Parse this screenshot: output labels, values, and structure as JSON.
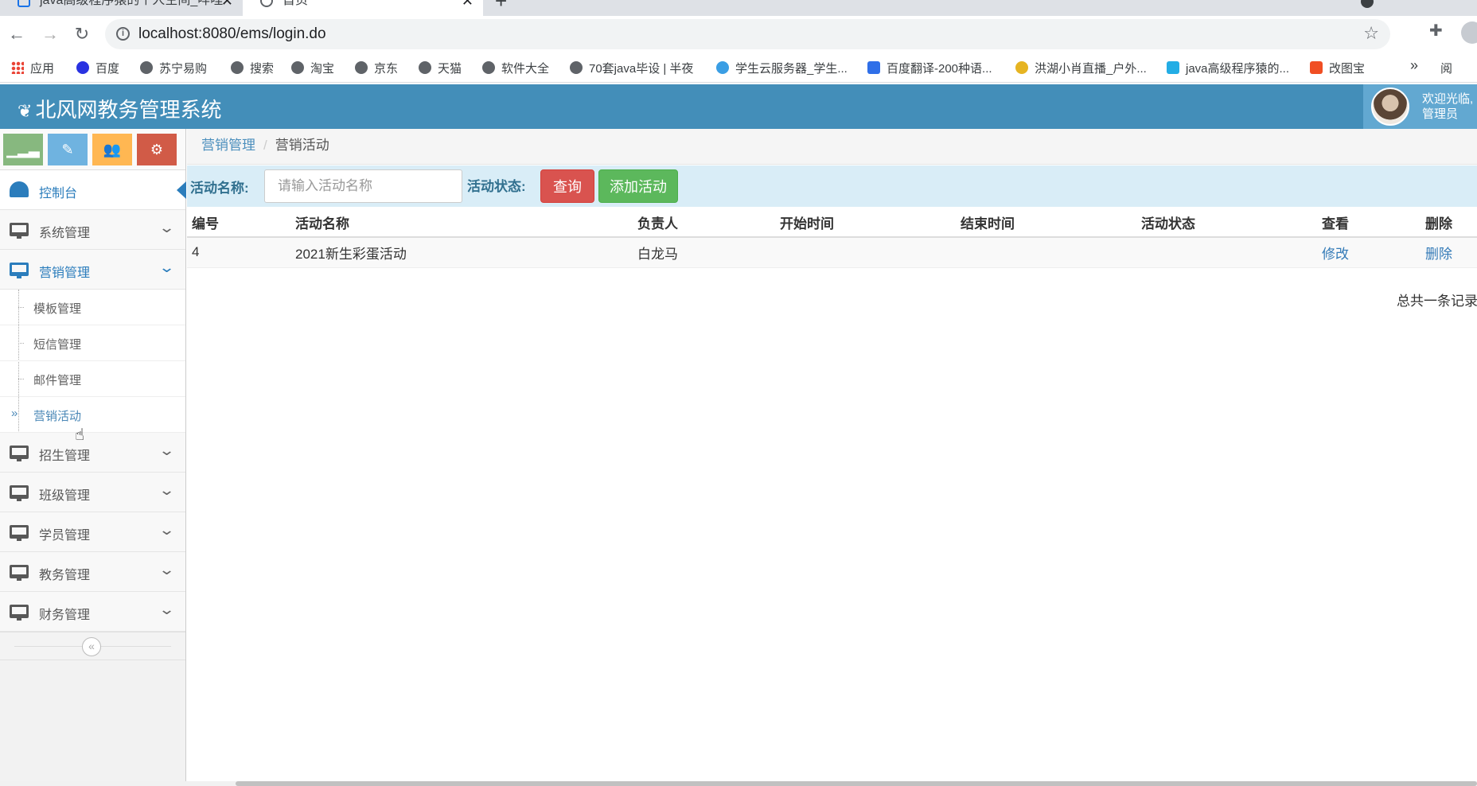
{
  "browser": {
    "tabs": [
      {
        "title": "java高级程序猿的个人空间_哔哩"
      },
      {
        "title": "首页"
      }
    ],
    "url": "localhost:8080/ems/login.do",
    "bookmarks": [
      {
        "label": "应用",
        "icon": "apps-grid-icon"
      },
      {
        "label": "百度",
        "icon": "baidu-paw-icon"
      },
      {
        "label": "苏宁易购",
        "icon": "globe-icon"
      },
      {
        "label": "搜索",
        "icon": "globe-icon"
      },
      {
        "label": "淘宝",
        "icon": "globe-icon"
      },
      {
        "label": "京东",
        "icon": "globe-icon"
      },
      {
        "label": "天猫",
        "icon": "globe-icon"
      },
      {
        "label": "软件大全",
        "icon": "globe-icon"
      },
      {
        "label": "70套java毕设 | 半夜",
        "icon": "globe-icon"
      },
      {
        "label": "学生云服务器_学生...",
        "icon": "cloud-icon"
      },
      {
        "label": "百度翻译-200种语...",
        "icon": "translate-icon"
      },
      {
        "label": "洪湖小肖直播_户外...",
        "icon": "live-icon"
      },
      {
        "label": "java高级程序猿的...",
        "icon": "bilibili-icon"
      },
      {
        "label": "改图宝",
        "icon": "image-tool-icon"
      }
    ],
    "bookmarks_more": "»",
    "reading_list": "阅"
  },
  "app": {
    "title": "北风网教务管理系统",
    "welcome_line1": "欢迎光临,",
    "welcome_line2": "管理员",
    "colors": {
      "header": "#438eb9",
      "user_box": "#62a8d1",
      "accent": "#2b7dbc",
      "shortcut_green": "#87b87f",
      "shortcut_blue": "#6fb3e0",
      "shortcut_orange": "#ffb752",
      "shortcut_red": "#d15b47"
    }
  },
  "sidebar": {
    "dashboard": "控制台",
    "menus": [
      {
        "label": "系统管理"
      },
      {
        "label": "营销管理"
      },
      {
        "label": "招生管理"
      },
      {
        "label": "班级管理"
      },
      {
        "label": "学员管理"
      },
      {
        "label": "教务管理"
      },
      {
        "label": "财务管理"
      }
    ],
    "marketing_sub": [
      {
        "label": "模板管理"
      },
      {
        "label": "短信管理"
      },
      {
        "label": "邮件管理"
      },
      {
        "label": "营销活动"
      }
    ]
  },
  "main": {
    "breadcrumb": {
      "parent": "营销管理",
      "current": "营销活动"
    },
    "search": {
      "name_label": "活动名称:",
      "name_placeholder": "请输入活动名称",
      "status_label": "活动状态:",
      "query_button": "查询",
      "add_button": "添加活动"
    },
    "table": {
      "columns": [
        "编号",
        "活动名称",
        "负责人",
        "开始时间",
        "结束时间",
        "活动状态",
        "查看",
        "删除"
      ],
      "rows": [
        {
          "id": "4",
          "name": "2021新生彩蛋活动",
          "owner": "白龙马",
          "start": "",
          "end": "",
          "status": "",
          "view": "修改",
          "delete": "删除"
        }
      ]
    },
    "total_text": "总共一条记录"
  }
}
